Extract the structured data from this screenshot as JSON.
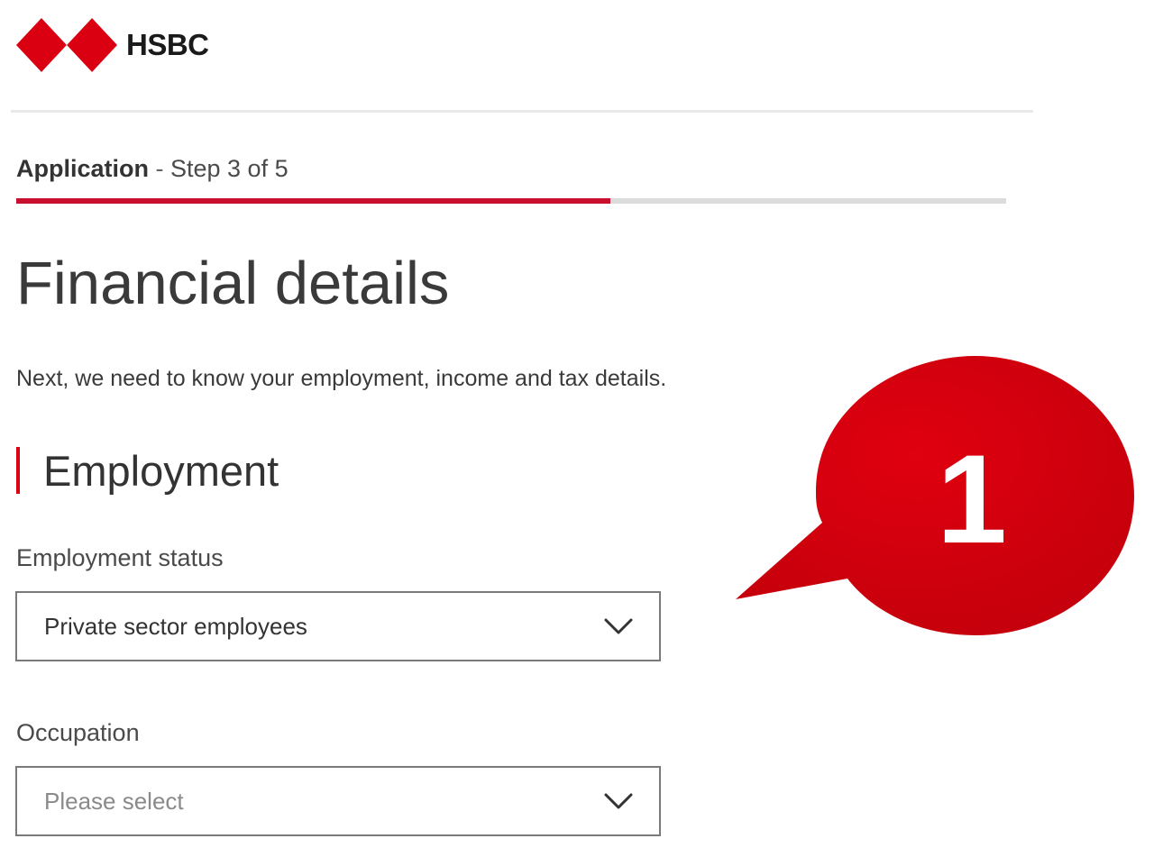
{
  "header": {
    "brand_name": "HSBC",
    "logo_icon": "hsbc-hexagon-logo",
    "brand_color": "#db0011"
  },
  "progress": {
    "label": "Application",
    "separator": " - ",
    "step_text": "Step 3 of 5",
    "current_step": 3,
    "total_steps": 5,
    "fill_fraction": 0.6,
    "fill_color": "#c8102e"
  },
  "page": {
    "title": "Financial details",
    "intro": "Next, we need to know your employment, income and tax details."
  },
  "section": {
    "title": "Employment"
  },
  "fields": {
    "employment_status": {
      "label": "Employment status",
      "value": "Private sector employees",
      "icon": "chevron-down-icon"
    },
    "occupation": {
      "label": "Occupation",
      "placeholder": "Please select",
      "icon": "chevron-down-icon"
    }
  },
  "callout": {
    "number": "1",
    "color": "#d4000f"
  }
}
